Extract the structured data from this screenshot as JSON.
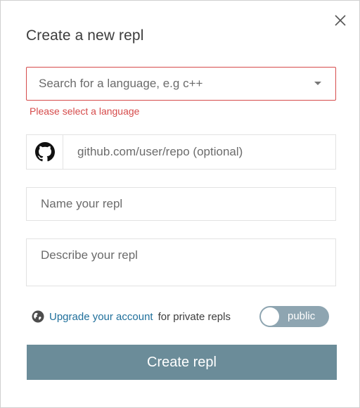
{
  "modal": {
    "title": "Create a new repl",
    "close_icon": "close-icon"
  },
  "language": {
    "placeholder": "Search for a language, e.g c++",
    "error": "Please select a language",
    "caret_icon": "caret-down-icon"
  },
  "repo": {
    "icon": "github-icon",
    "placeholder": "github.com/user/repo (optional)"
  },
  "name_field": {
    "placeholder": "Name your repl"
  },
  "description_field": {
    "placeholder": "Describe your repl"
  },
  "privacy": {
    "icon": "globe-icon",
    "upgrade_link": "Upgrade your account",
    "suffix": "for private repls",
    "toggle_label": "public",
    "toggle_state": "public"
  },
  "submit": {
    "label": "Create repl"
  },
  "colors": {
    "error": "#d64b4b",
    "link": "#1f6f9b",
    "toggle": "#8ea5b1",
    "button": "#6b8c99"
  }
}
